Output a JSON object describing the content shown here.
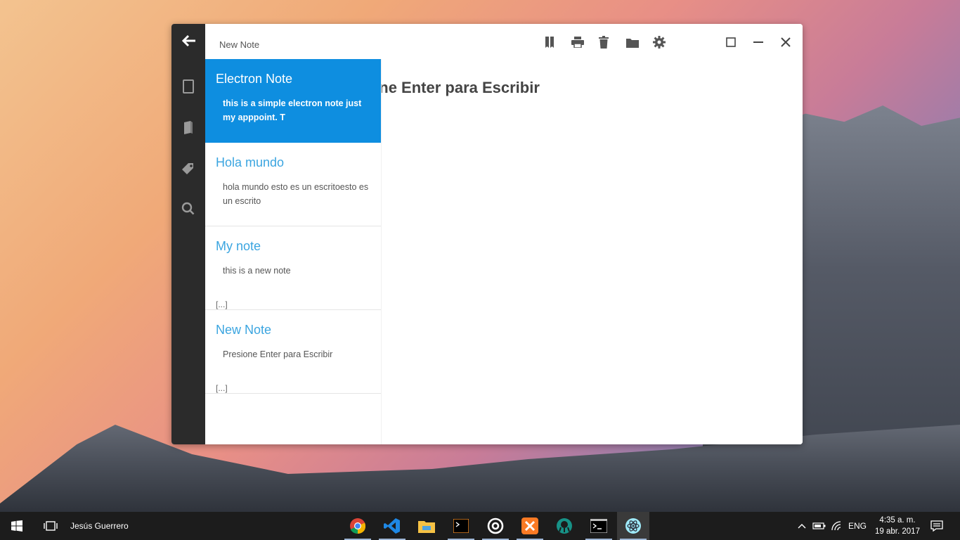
{
  "window": {
    "title": "New Note",
    "editor_title": "Presione Enter para Escribir"
  },
  "toolbar": {
    "icons": [
      "bookmark-icon",
      "print-icon",
      "trash-icon",
      "folder-icon",
      "gear-icon"
    ],
    "window_controls": [
      "maximize-icon",
      "minimize-icon",
      "close-icon"
    ]
  },
  "rail": {
    "items": [
      "back-arrow-icon",
      "note-icon",
      "notebook-icon",
      "tag-icon",
      "search-icon"
    ]
  },
  "notes": [
    {
      "title": "Electron Note",
      "body": "this is a simple electron note just my apppoint. T",
      "ellipsis": ""
    },
    {
      "title": "Hola mundo",
      "body": "hola mundo esto es un escritoesto es un escrito",
      "ellipsis": ""
    },
    {
      "title": "My note",
      "body": "this is a new note",
      "ellipsis": "[...]"
    },
    {
      "title": "New Note",
      "body": "Presione Enter para Escribir",
      "ellipsis": "[...]"
    }
  ],
  "taskbar": {
    "user": "Jesús Guerrero",
    "apps": [
      "chrome-icon",
      "vscode-icon",
      "file-explorer-icon",
      "terminal-icon",
      "app-icon",
      "xampp-icon",
      "gitkraken-icon",
      "cmd-icon",
      "electron-icon"
    ],
    "language": "ENG",
    "time": "4:35 a. m.",
    "date": "19 abr. 2017"
  },
  "colors": {
    "accent": "#0e8ee0",
    "note_title": "#3ba5e0",
    "rail": "#2b2b2b"
  }
}
